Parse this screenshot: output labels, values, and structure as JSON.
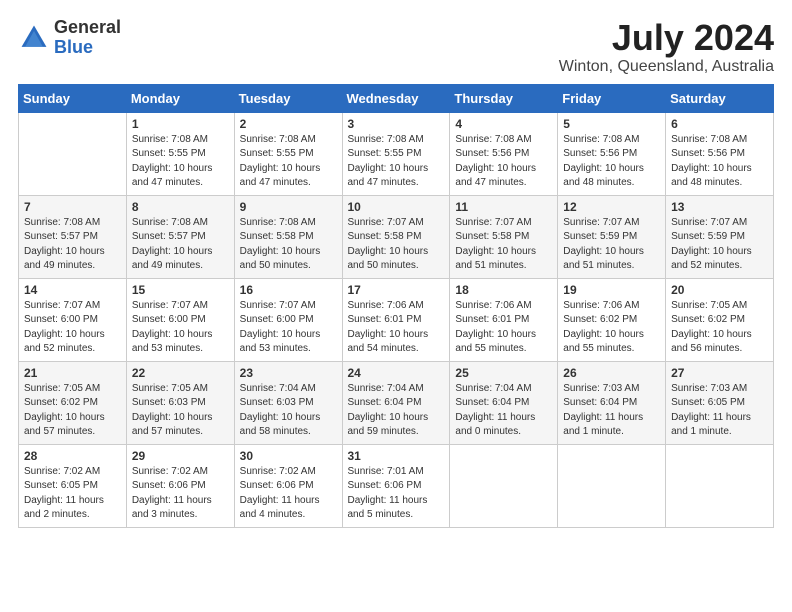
{
  "header": {
    "logo_general": "General",
    "logo_blue": "Blue",
    "month_year": "July 2024",
    "location": "Winton, Queensland, Australia"
  },
  "weekdays": [
    "Sunday",
    "Monday",
    "Tuesday",
    "Wednesday",
    "Thursday",
    "Friday",
    "Saturday"
  ],
  "weeks": [
    [
      {
        "day": "",
        "info": ""
      },
      {
        "day": "1",
        "info": "Sunrise: 7:08 AM\nSunset: 5:55 PM\nDaylight: 10 hours\nand 47 minutes."
      },
      {
        "day": "2",
        "info": "Sunrise: 7:08 AM\nSunset: 5:55 PM\nDaylight: 10 hours\nand 47 minutes."
      },
      {
        "day": "3",
        "info": "Sunrise: 7:08 AM\nSunset: 5:55 PM\nDaylight: 10 hours\nand 47 minutes."
      },
      {
        "day": "4",
        "info": "Sunrise: 7:08 AM\nSunset: 5:56 PM\nDaylight: 10 hours\nand 47 minutes."
      },
      {
        "day": "5",
        "info": "Sunrise: 7:08 AM\nSunset: 5:56 PM\nDaylight: 10 hours\nand 48 minutes."
      },
      {
        "day": "6",
        "info": "Sunrise: 7:08 AM\nSunset: 5:56 PM\nDaylight: 10 hours\nand 48 minutes."
      }
    ],
    [
      {
        "day": "7",
        "info": "Sunrise: 7:08 AM\nSunset: 5:57 PM\nDaylight: 10 hours\nand 49 minutes."
      },
      {
        "day": "8",
        "info": "Sunrise: 7:08 AM\nSunset: 5:57 PM\nDaylight: 10 hours\nand 49 minutes."
      },
      {
        "day": "9",
        "info": "Sunrise: 7:08 AM\nSunset: 5:58 PM\nDaylight: 10 hours\nand 50 minutes."
      },
      {
        "day": "10",
        "info": "Sunrise: 7:07 AM\nSunset: 5:58 PM\nDaylight: 10 hours\nand 50 minutes."
      },
      {
        "day": "11",
        "info": "Sunrise: 7:07 AM\nSunset: 5:58 PM\nDaylight: 10 hours\nand 51 minutes."
      },
      {
        "day": "12",
        "info": "Sunrise: 7:07 AM\nSunset: 5:59 PM\nDaylight: 10 hours\nand 51 minutes."
      },
      {
        "day": "13",
        "info": "Sunrise: 7:07 AM\nSunset: 5:59 PM\nDaylight: 10 hours\nand 52 minutes."
      }
    ],
    [
      {
        "day": "14",
        "info": "Sunrise: 7:07 AM\nSunset: 6:00 PM\nDaylight: 10 hours\nand 52 minutes."
      },
      {
        "day": "15",
        "info": "Sunrise: 7:07 AM\nSunset: 6:00 PM\nDaylight: 10 hours\nand 53 minutes."
      },
      {
        "day": "16",
        "info": "Sunrise: 7:07 AM\nSunset: 6:00 PM\nDaylight: 10 hours\nand 53 minutes."
      },
      {
        "day": "17",
        "info": "Sunrise: 7:06 AM\nSunset: 6:01 PM\nDaylight: 10 hours\nand 54 minutes."
      },
      {
        "day": "18",
        "info": "Sunrise: 7:06 AM\nSunset: 6:01 PM\nDaylight: 10 hours\nand 55 minutes."
      },
      {
        "day": "19",
        "info": "Sunrise: 7:06 AM\nSunset: 6:02 PM\nDaylight: 10 hours\nand 55 minutes."
      },
      {
        "day": "20",
        "info": "Sunrise: 7:05 AM\nSunset: 6:02 PM\nDaylight: 10 hours\nand 56 minutes."
      }
    ],
    [
      {
        "day": "21",
        "info": "Sunrise: 7:05 AM\nSunset: 6:02 PM\nDaylight: 10 hours\nand 57 minutes."
      },
      {
        "day": "22",
        "info": "Sunrise: 7:05 AM\nSunset: 6:03 PM\nDaylight: 10 hours\nand 57 minutes."
      },
      {
        "day": "23",
        "info": "Sunrise: 7:04 AM\nSunset: 6:03 PM\nDaylight: 10 hours\nand 58 minutes."
      },
      {
        "day": "24",
        "info": "Sunrise: 7:04 AM\nSunset: 6:04 PM\nDaylight: 10 hours\nand 59 minutes."
      },
      {
        "day": "25",
        "info": "Sunrise: 7:04 AM\nSunset: 6:04 PM\nDaylight: 11 hours\nand 0 minutes."
      },
      {
        "day": "26",
        "info": "Sunrise: 7:03 AM\nSunset: 6:04 PM\nDaylight: 11 hours\nand 1 minute."
      },
      {
        "day": "27",
        "info": "Sunrise: 7:03 AM\nSunset: 6:05 PM\nDaylight: 11 hours\nand 1 minute."
      }
    ],
    [
      {
        "day": "28",
        "info": "Sunrise: 7:02 AM\nSunset: 6:05 PM\nDaylight: 11 hours\nand 2 minutes."
      },
      {
        "day": "29",
        "info": "Sunrise: 7:02 AM\nSunset: 6:06 PM\nDaylight: 11 hours\nand 3 minutes."
      },
      {
        "day": "30",
        "info": "Sunrise: 7:02 AM\nSunset: 6:06 PM\nDaylight: 11 hours\nand 4 minutes."
      },
      {
        "day": "31",
        "info": "Sunrise: 7:01 AM\nSunset: 6:06 PM\nDaylight: 11 hours\nand 5 minutes."
      },
      {
        "day": "",
        "info": ""
      },
      {
        "day": "",
        "info": ""
      },
      {
        "day": "",
        "info": ""
      }
    ]
  ]
}
